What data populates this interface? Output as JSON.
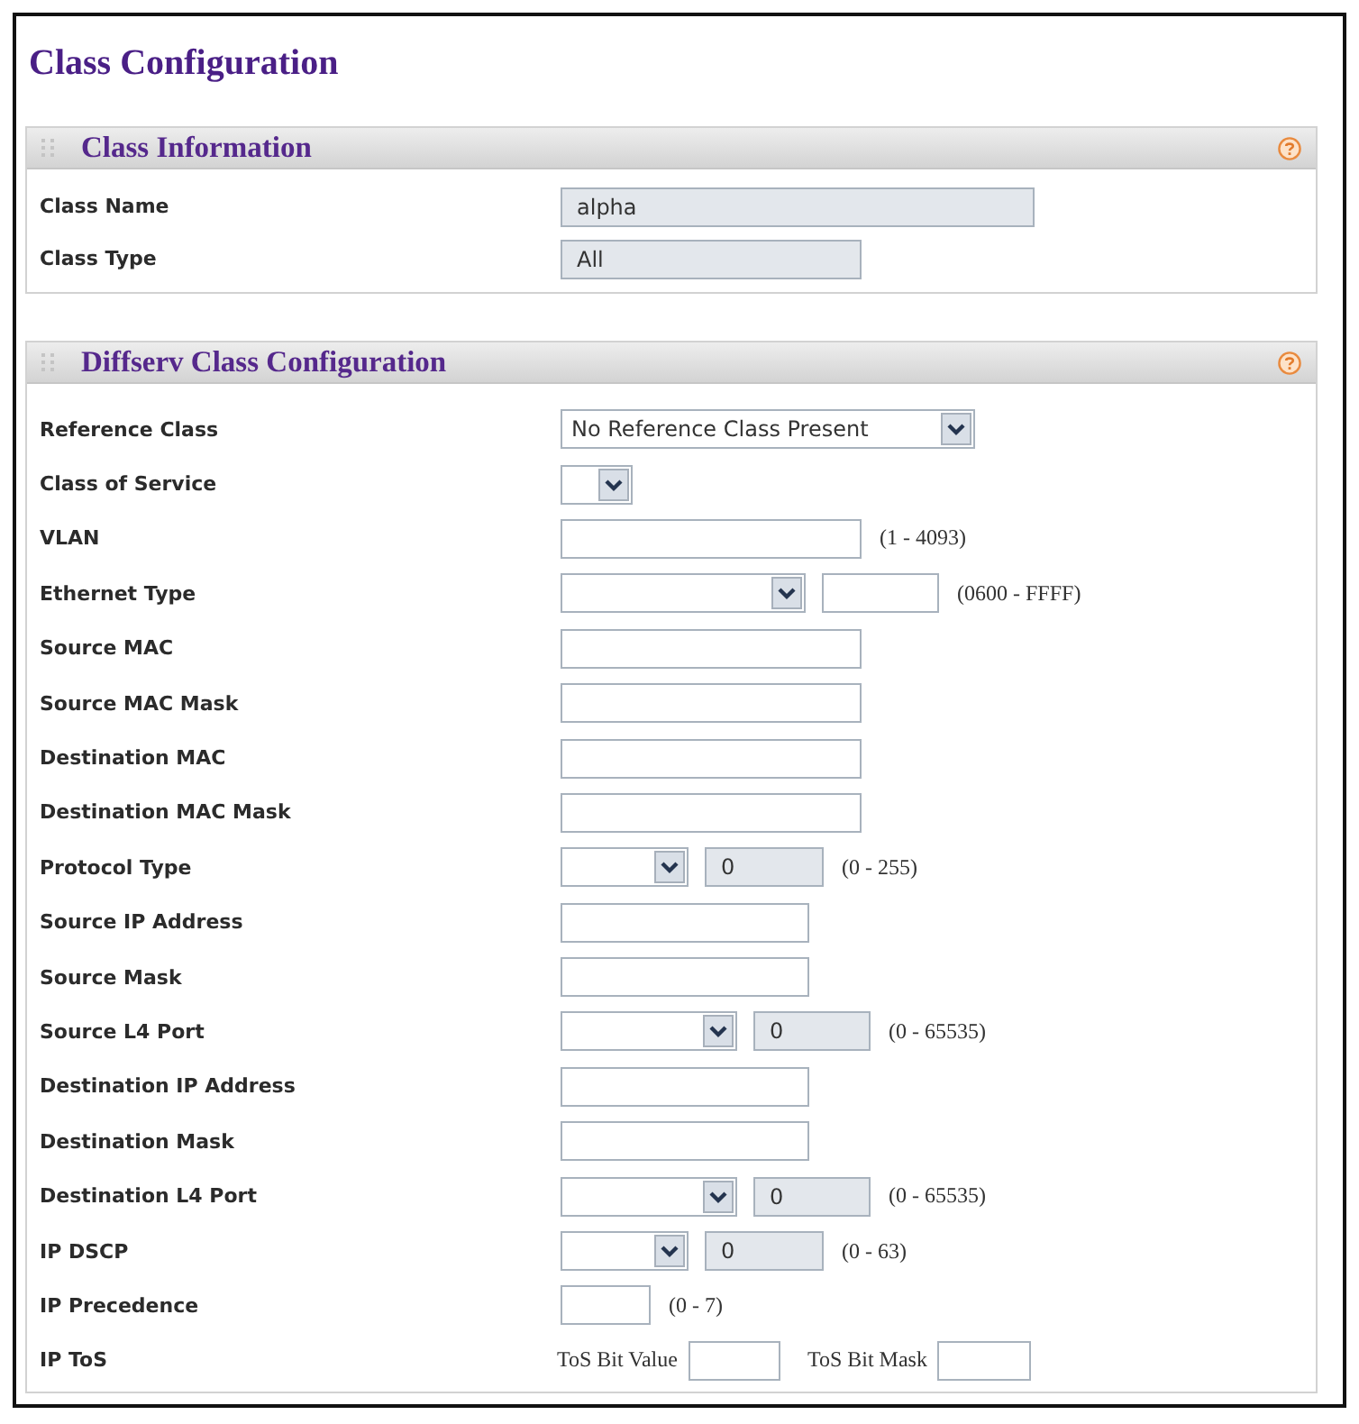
{
  "title": "Class Configuration",
  "sections": [
    {
      "title": "Class Information",
      "rows": [
        {
          "label": "Class Name",
          "controls": [
            {
              "kind": "input",
              "value": "alpha",
              "disabled": true
            }
          ]
        },
        {
          "label": "Class Type",
          "controls": [
            {
              "kind": "input",
              "value": "All",
              "disabled": true
            }
          ]
        }
      ]
    },
    {
      "title": "Diffserv Class Configuration",
      "rows": [
        {
          "label": "Reference Class",
          "controls": [
            {
              "kind": "select",
              "value": "No Reference Class Present"
            }
          ]
        },
        {
          "label": "Class of Service",
          "controls": [
            {
              "kind": "select"
            }
          ]
        },
        {
          "label": "VLAN",
          "controls": [
            {
              "kind": "input",
              "disabled": false
            },
            {
              "kind": "hint",
              "text": "(1 - 4093)"
            }
          ]
        },
        {
          "label": "Ethernet Type",
          "controls": [
            {
              "kind": "select"
            },
            {
              "kind": "input",
              "disabled": false
            },
            {
              "kind": "hint",
              "text": "(0600 - FFFF)"
            }
          ]
        },
        {
          "label": "Source MAC",
          "controls": [
            {
              "kind": "input",
              "disabled": false
            }
          ]
        },
        {
          "label": "Source MAC Mask",
          "controls": [
            {
              "kind": "input",
              "disabled": false
            }
          ]
        },
        {
          "label": "Destination MAC",
          "controls": [
            {
              "kind": "input",
              "disabled": false
            }
          ]
        },
        {
          "label": "Destination MAC Mask",
          "controls": [
            {
              "kind": "input",
              "disabled": false
            }
          ]
        },
        {
          "label": "Protocol Type",
          "controls": [
            {
              "kind": "select"
            },
            {
              "kind": "input",
              "value": "0",
              "disabled": true
            },
            {
              "kind": "hint",
              "text": "(0 - 255)"
            }
          ]
        },
        {
          "label": "Source IP Address",
          "controls": [
            {
              "kind": "input",
              "disabled": false
            }
          ]
        },
        {
          "label": "Source Mask",
          "controls": [
            {
              "kind": "input",
              "disabled": false
            }
          ]
        },
        {
          "label": "Source L4 Port",
          "controls": [
            {
              "kind": "select"
            },
            {
              "kind": "input",
              "value": "0",
              "disabled": true
            },
            {
              "kind": "hint",
              "text": "(0 - 65535)"
            }
          ]
        },
        {
          "label": "Destination IP Address",
          "controls": [
            {
              "kind": "input",
              "disabled": false
            }
          ]
        },
        {
          "label": "Destination Mask",
          "controls": [
            {
              "kind": "input",
              "disabled": false
            }
          ]
        },
        {
          "label": "Destination L4 Port",
          "controls": [
            {
              "kind": "select"
            },
            {
              "kind": "input",
              "value": "0",
              "disabled": true
            },
            {
              "kind": "hint",
              "text": "(0 - 65535)"
            }
          ]
        },
        {
          "label": "IP DSCP",
          "controls": [
            {
              "kind": "select"
            },
            {
              "kind": "input",
              "value": "0",
              "disabled": true
            },
            {
              "kind": "hint",
              "text": "(0 - 63)"
            }
          ]
        },
        {
          "label": "IP Precedence",
          "controls": [
            {
              "kind": "input",
              "disabled": false
            },
            {
              "kind": "hint",
              "text": "(0 - 7)"
            }
          ]
        },
        {
          "label": "IP ToS",
          "controls": [
            {
              "kind": "caption",
              "text": "ToS Bit Value"
            },
            {
              "kind": "input",
              "disabled": false
            },
            {
              "kind": "caption",
              "text": "ToS Bit Mask"
            },
            {
              "kind": "input",
              "disabled": false
            }
          ]
        }
      ]
    }
  ]
}
